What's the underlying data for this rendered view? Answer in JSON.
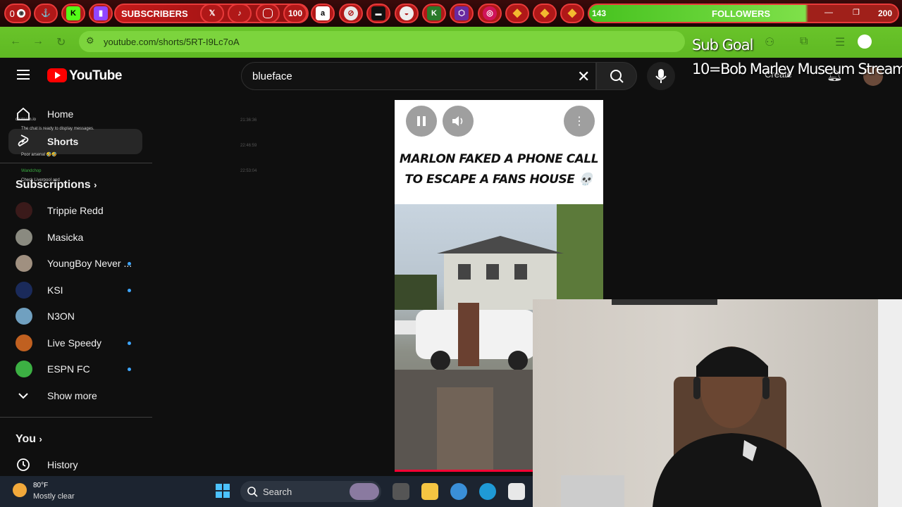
{
  "overlay": {
    "left_counter": "0",
    "subscribers_label": "SUBSCRIBERS",
    "sub_badge": "100",
    "followers_count": "143",
    "followers_label": "FOLLOWERS",
    "followers_goal": "200",
    "sub_goal_title": "Sub Goal",
    "sub_goal_detail": "10=Bob Marley Museum Stream",
    "chat_notice": "The chat is ready to display messages.",
    "chat_user_1": "chatcom.io",
    "chat_user_2": "Wandchop",
    "chat_msg_1": "Poor arsenal 🤣🤣",
    "chat_msg_2": "Check Liverpool and",
    "timestamps": [
      "21:36:36",
      "22:46:59",
      "22:53:04"
    ]
  },
  "browser": {
    "url": "youtube.com/shorts/5RT-I9Lc7oA"
  },
  "youtube": {
    "logo_text": "YouTube",
    "search_value": "blueface",
    "create_label": "Create"
  },
  "sidebar": {
    "home": "Home",
    "shorts": "Shorts",
    "subscriptions": "Subscriptions",
    "channels": [
      {
        "name": "Trippie Redd",
        "avatar": "#3a1a1a",
        "live": false
      },
      {
        "name": "Masicka",
        "avatar": "#8a8a80",
        "live": false
      },
      {
        "name": "YoungBoy Never ...",
        "avatar": "#a09080",
        "live": true
      },
      {
        "name": "KSI",
        "avatar": "#1a2a5a",
        "live": true
      },
      {
        "name": "N3ON",
        "avatar": "#70a0c0",
        "live": false
      },
      {
        "name": "Live Speedy",
        "avatar": "#c06020",
        "live": true
      },
      {
        "name": "ESPN FC",
        "avatar": "#3cb043",
        "live": true
      }
    ],
    "show_more": "Show more",
    "you": "You",
    "history": "History"
  },
  "video": {
    "caption": "MARLON FAKED A PHONE CALL TO ESCAPE A FANS HOUSE 💀"
  },
  "taskbar": {
    "temperature": "80°F",
    "weather": "Mostly clear",
    "search_label": "Search"
  }
}
